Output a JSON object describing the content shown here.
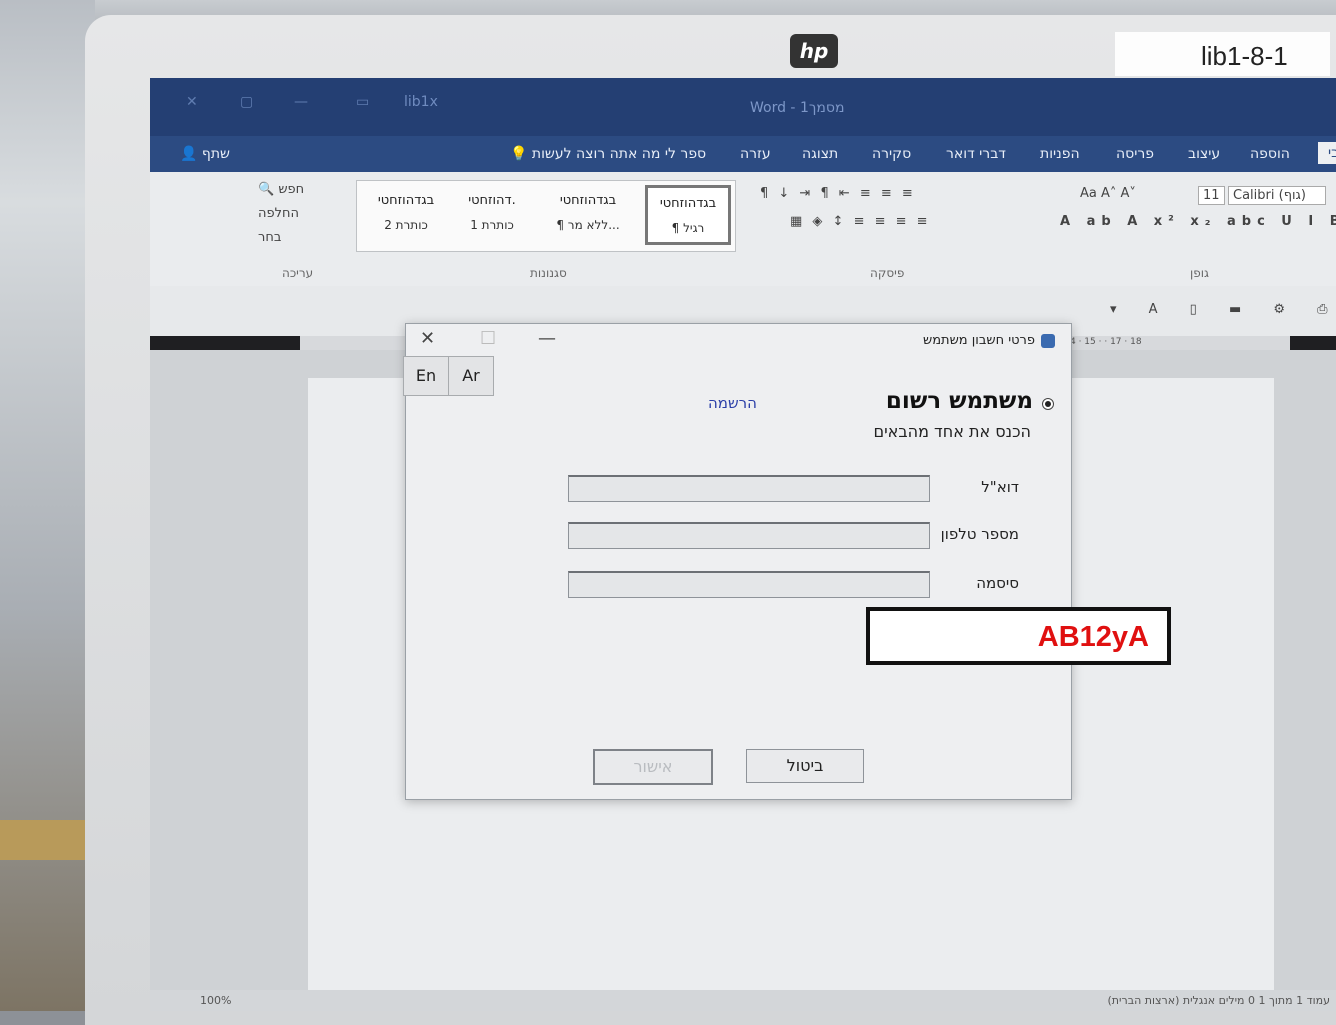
{
  "monitor": {
    "brand_logo": "hp",
    "label": "lib1-8-1"
  },
  "word": {
    "window_title": "Word - מסמך1",
    "doc_short": "lib1x",
    "tabs": [
      "הוספה",
      "עיצוב",
      "פריסה",
      "הפניות",
      "דברי דואר",
      "סקירה",
      "תצוגה",
      "עזרה"
    ],
    "tell_me": "ספר לי מה אתה רוצה לעשות",
    "share": "שתף",
    "font_name": "Calibri (גוף)",
    "font_size": "11",
    "find": "חפש",
    "replace": "החלפה",
    "select": "בחר",
    "styles": [
      {
        "preview": "בגדהוזחטי",
        "name": "¶ רגיל"
      },
      {
        "preview": "בגדהוזחטי",
        "name": "¶ ללא מר..."
      },
      {
        "preview": "בגדהוזחטי",
        "name": "כותרת 1"
      },
      {
        "preview": "דהוזחטי.",
        "name": "כותרת 2"
      },
      {
        "preview": "בגדהוזחטי",
        "name": ""
      }
    ],
    "groups": {
      "font": "גופן",
      "paragraph": "פיסקה",
      "styles": "סגנונות",
      "editing": "עריכה"
    },
    "ruler_text": "4 · 15 · · 17 · 18",
    "status_text": "עמוד 1 מתוך 1   0 מילים   אנגלית (ארצות הברית)",
    "zoom": "100%"
  },
  "dialog": {
    "title": "פרטי חשבון משתמש",
    "lang_en": "En",
    "lang_ar": "Ar",
    "heading": "משתמש רשום",
    "register_link": "הרשמה",
    "subtitle": "הכנס את אחד מהבאים",
    "fields": [
      {
        "label": "דוא\"ל",
        "value": ""
      },
      {
        "label": "מספר טלפון",
        "value": ""
      },
      {
        "label": "סיסמה",
        "value": ""
      }
    ],
    "ok_label": "אישור",
    "cancel_label": "ביטול"
  },
  "annotation": {
    "text": "AB12yA",
    "color": "#e01010"
  }
}
